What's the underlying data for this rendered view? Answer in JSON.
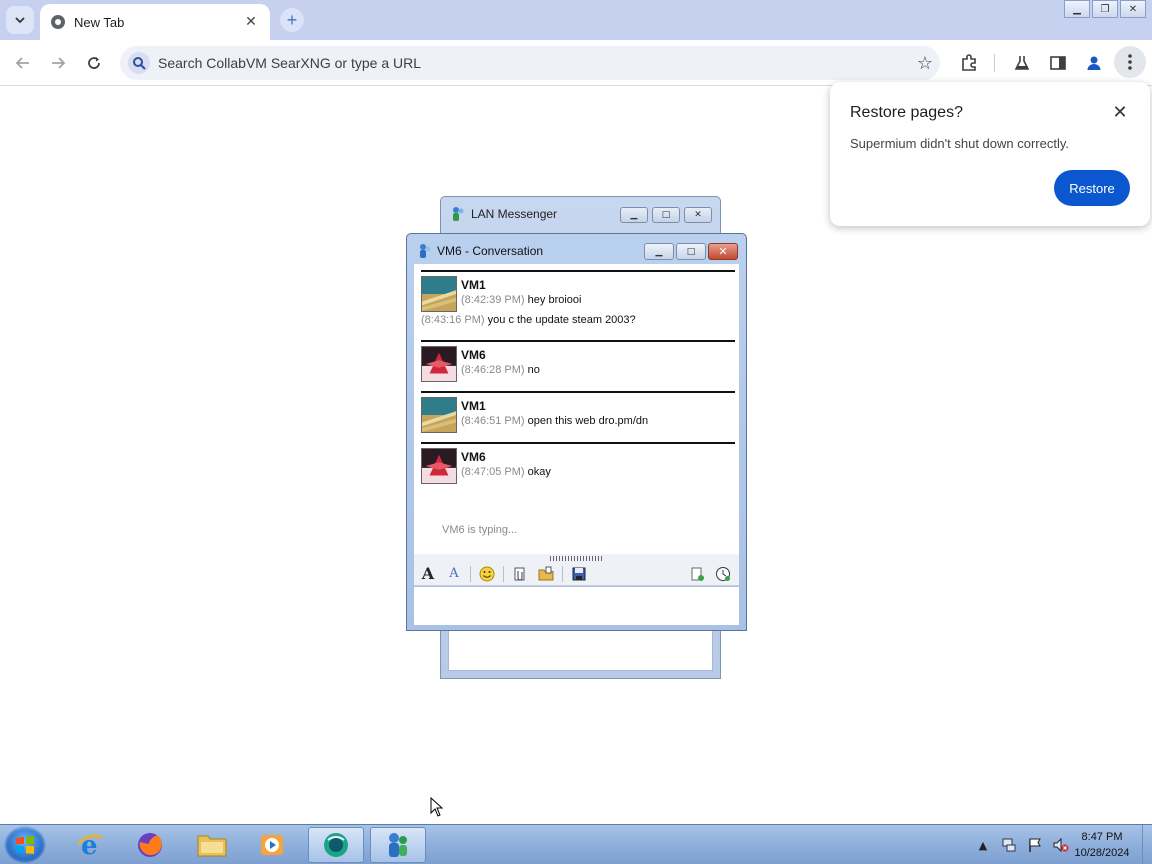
{
  "browser": {
    "tab_title": "New Tab",
    "omnibox_placeholder": "Search CollabVM SearXNG or type a URL"
  },
  "restore_popup": {
    "title": "Restore pages?",
    "message": "Supermium didn't shut down correctly.",
    "button_label": "Restore"
  },
  "lan_messenger": {
    "title": "LAN Messenger"
  },
  "conversation": {
    "title": "VM6 - Conversation",
    "messages": [
      {
        "sender": "VM1",
        "lines": [
          {
            "time": "(8:42:39 PM)",
            "text": "hey broiooi"
          },
          {
            "time": "(8:43:16 PM)",
            "text": "you c the update steam 2003?"
          }
        ]
      },
      {
        "sender": "VM6",
        "lines": [
          {
            "time": "(8:46:28 PM)",
            "text": "no"
          }
        ]
      },
      {
        "sender": "VM1",
        "lines": [
          {
            "time": "(8:46:51 PM)",
            "text": "open this web dro.pm/dn"
          }
        ]
      },
      {
        "sender": "VM6",
        "lines": [
          {
            "time": "(8:47:05 PM)",
            "text": "okay"
          }
        ]
      }
    ],
    "typing_status": "VM6 is typing..."
  },
  "taskbar": {
    "clock_time": "8:47 PM",
    "clock_date": "10/28/2024"
  },
  "colors": {
    "accent": "#0b57d0",
    "tabstrip": "#c6d1f0",
    "taskbar": "#8fb0dc"
  }
}
